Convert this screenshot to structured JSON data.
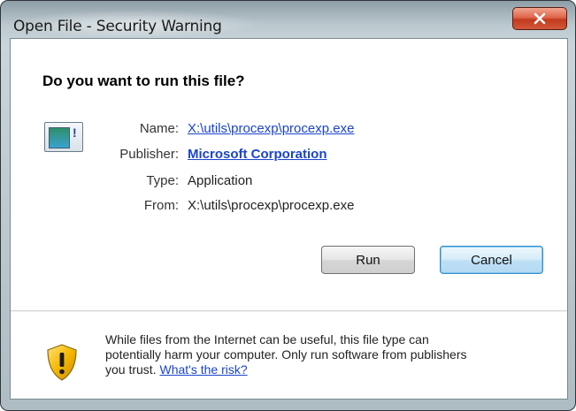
{
  "window": {
    "title": "Open File - Security Warning",
    "close_icon": "close-icon"
  },
  "dialog": {
    "question": "Do you want to run this file?",
    "file_icon": "application-file-icon",
    "fields": {
      "name": {
        "label": "Name:",
        "value": "X:\\utils\\procexp\\procexp.exe"
      },
      "publisher": {
        "label": "Publisher:",
        "value": "Microsoft Corporation"
      },
      "type": {
        "label": "Type:",
        "value": "Application"
      },
      "from": {
        "label": "From:",
        "value": "X:\\utils\\procexp\\procexp.exe"
      }
    },
    "buttons": {
      "run": "Run",
      "cancel": "Cancel"
    }
  },
  "footer": {
    "shield_icon": "warning-shield-icon",
    "line1": "While files from the Internet can be useful, this file type can",
    "line2": "potentially harm your computer. Only run software from publishers",
    "line3_prefix": "you trust.",
    "risk_link": "What's the risk?"
  },
  "colors": {
    "link": "#1a44cc",
    "close_button": "#c23a1e",
    "default_button_border": "#3a8bc7",
    "warning_shield": "#f5b800"
  }
}
